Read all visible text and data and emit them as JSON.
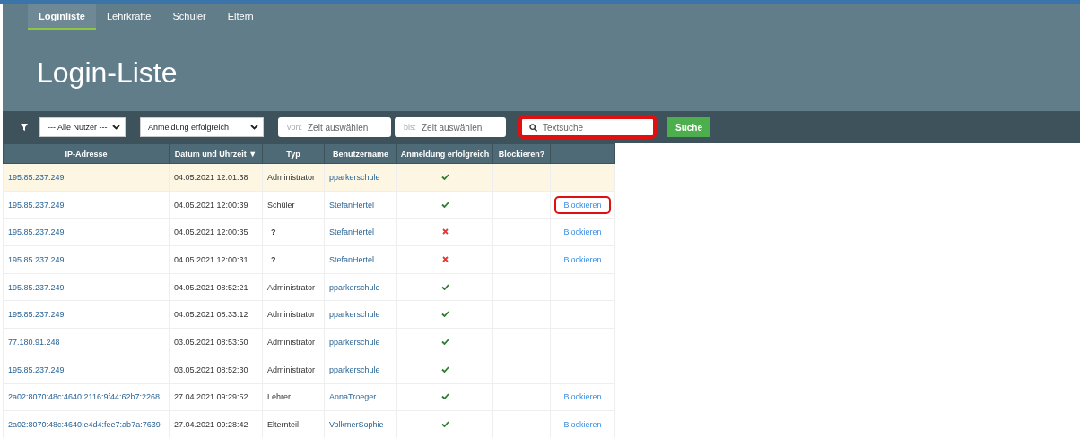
{
  "nav": {
    "tabs": [
      {
        "label": "Loginliste",
        "selected": true
      },
      {
        "label": "Lehrkräfte",
        "selected": false
      },
      {
        "label": "Schüler",
        "selected": false
      },
      {
        "label": "Eltern",
        "selected": false
      }
    ]
  },
  "title": "Login-Liste",
  "filters": {
    "user_select": "--- Alle Nutzer ---",
    "status_select": "Anmeldung erfolgreich",
    "from": {
      "prefix": "von:",
      "placeholder": "Zeit auswählen"
    },
    "to": {
      "prefix": "bis:",
      "placeholder": "Zeit auswählen"
    },
    "search": {
      "placeholder": "Textsuche",
      "highlighted": true
    },
    "search_button": "Suche"
  },
  "table": {
    "columns": [
      {
        "label": "IP-Adresse"
      },
      {
        "label": "Datum und Uhrzeit",
        "sort_mark": "▼"
      },
      {
        "label": "Typ"
      },
      {
        "label": "Benutzername"
      },
      {
        "label": "Anmeldung erfolgreich"
      },
      {
        "label": "Blockieren?"
      }
    ],
    "rows": [
      {
        "ip": "195.85.237.249",
        "time": "04.05.2021 12:01:38",
        "type": "Administrator",
        "user": "pparkerschule",
        "success": true,
        "selected": true
      },
      {
        "ip": "195.85.237.249",
        "time": "04.05.2021 12:00:39",
        "type": "Schüler",
        "user": "StefanHertel",
        "success": true,
        "selected": false,
        "action": "Blockieren",
        "highlighted": true
      },
      {
        "ip": "195.85.237.249",
        "time": "04.05.2021 12:00:35",
        "type": "?",
        "user": "StefanHertel",
        "success": false,
        "selected": false,
        "action": "Blockieren"
      },
      {
        "ip": "195.85.237.249",
        "time": "04.05.2021 12:00:31",
        "type": "?",
        "user": "StefanHertel",
        "success": false,
        "selected": false,
        "action": "Blockieren"
      },
      {
        "ip": "195.85.237.249",
        "time": "04.05.2021 08:52:21",
        "type": "Administrator",
        "user": "pparkerschule",
        "success": true,
        "selected": false
      },
      {
        "ip": "195.85.237.249",
        "time": "04.05.2021 08:33:12",
        "type": "Administrator",
        "user": "pparkerschule",
        "success": true,
        "selected": false
      },
      {
        "ip": "77.180.91.248",
        "time": "03.05.2021 08:53:50",
        "type": "Administrator",
        "user": "pparkerschule",
        "success": true,
        "selected": false
      },
      {
        "ip": "195.85.237.249",
        "time": "03.05.2021 08:52:30",
        "type": "Administrator",
        "user": "pparkerschule",
        "success": true,
        "selected": false
      },
      {
        "ip": "2a02:8070:48c:4640:2116:9f44:62b7:2268",
        "time": "27.04.2021 09:29:52",
        "type": "Lehrer",
        "user": "AnnaTroeger",
        "success": true,
        "selected": false,
        "action": "Blockieren"
      },
      {
        "ip": "2a02:8070:48c:4640:e4d4:fee7:ab7a:7639",
        "time": "27.04.2021 09:28:42",
        "type": "Elternteil",
        "user": "VolkmerSophie",
        "success": true,
        "selected": false,
        "action": "Blockieren"
      }
    ]
  }
}
